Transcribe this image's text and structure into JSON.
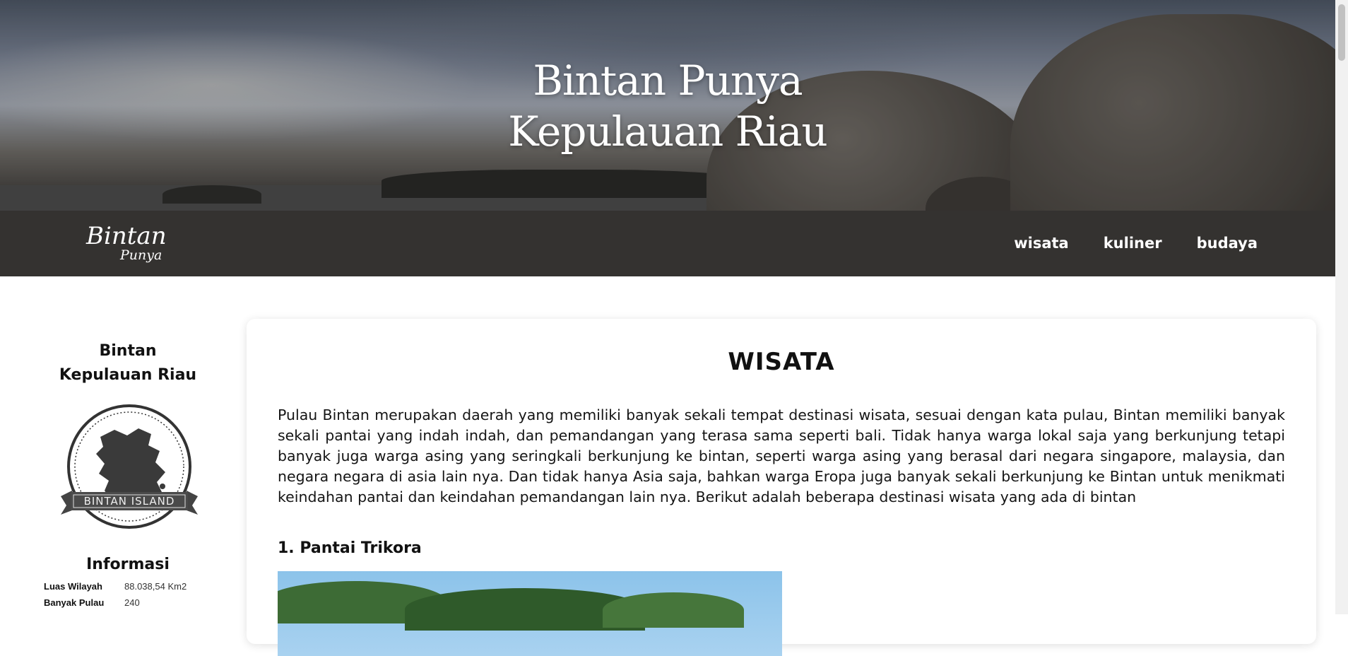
{
  "hero": {
    "title_line1": "Bintan Punya",
    "title_line2": "Kepulauan Riau"
  },
  "nav": {
    "logo_line1": "Bintan",
    "logo_line2": "Punya",
    "items": [
      {
        "label": "wisata"
      },
      {
        "label": "kuliner"
      },
      {
        "label": "budaya"
      }
    ]
  },
  "sidebar": {
    "title_line1": "Bintan",
    "title_line2": "Kepulauan Riau",
    "badge_text": "BINTAN ISLAND",
    "info_title": "Informasi",
    "info": [
      {
        "key": "Luas Wilayah",
        "value": "88.038,54 Km2"
      },
      {
        "key": "Banyak Pulau",
        "value": "240"
      }
    ]
  },
  "main": {
    "heading": "WISATA",
    "paragraph": "Pulau Bintan merupakan daerah yang memiliki banyak sekali tempat destinasi wisata, sesuai dengan kata pulau, Bintan memiliki banyak sekali pantai yang indah indah, dan pemandangan yang terasa sama seperti bali. Tidak hanya warga lokal saja yang berkunjung tetapi banyak juga warga asing yang seringkali berkunjung ke bintan, seperti warga asing yang berasal dari negara singapore, malaysia, dan negara negara di asia lain nya. Dan tidak hanya Asia saja, bahkan warga Eropa juga banyak sekali berkunjung ke Bintan untuk menikmati keindahan pantai dan keindahan pemandangan lain nya. Berikut adalah beberapa destinasi wisata yang ada di bintan",
    "subheading": "1. Pantai Trikora"
  },
  "colors": {
    "nav_bg": "#343230",
    "page_bg": "#ffffff",
    "text": "#111111"
  }
}
